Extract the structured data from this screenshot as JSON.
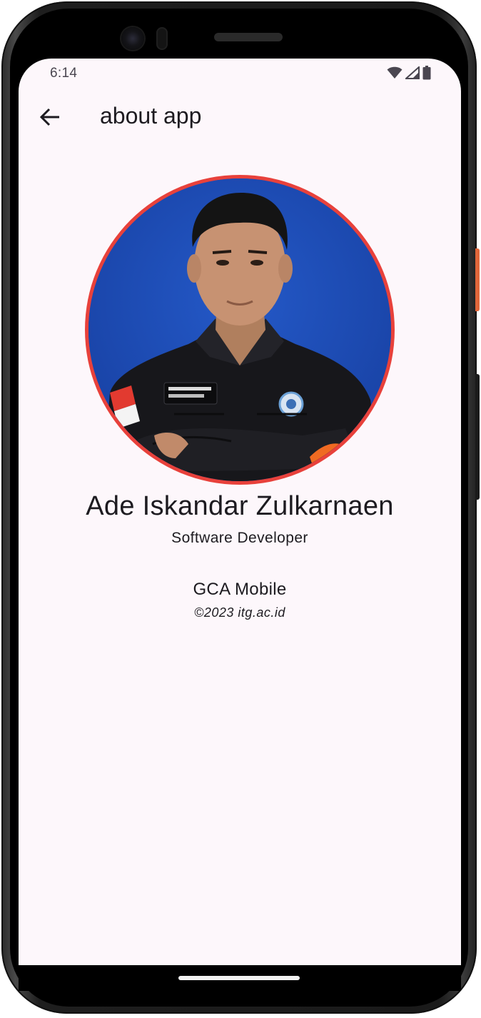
{
  "status_bar": {
    "time": "6:14",
    "icons": [
      "wifi-icon",
      "cell-signal-icon",
      "battery-icon"
    ]
  },
  "app_bar": {
    "back_icon": "arrow-back-icon",
    "title": "about app"
  },
  "profile": {
    "photo_ring_color": "#e8413b",
    "photo_bg_color": "#1d4fb8",
    "name": "Ade Iskandar Zulkarnaen",
    "role": "Software Developer"
  },
  "app_info": {
    "app_name": "GCA Mobile",
    "copyright": "©2023 itg.ac.id"
  },
  "colors": {
    "screen_background": "#fdf7fb",
    "text_primary": "#1d1b20",
    "accent_ring": "#e8413b"
  }
}
